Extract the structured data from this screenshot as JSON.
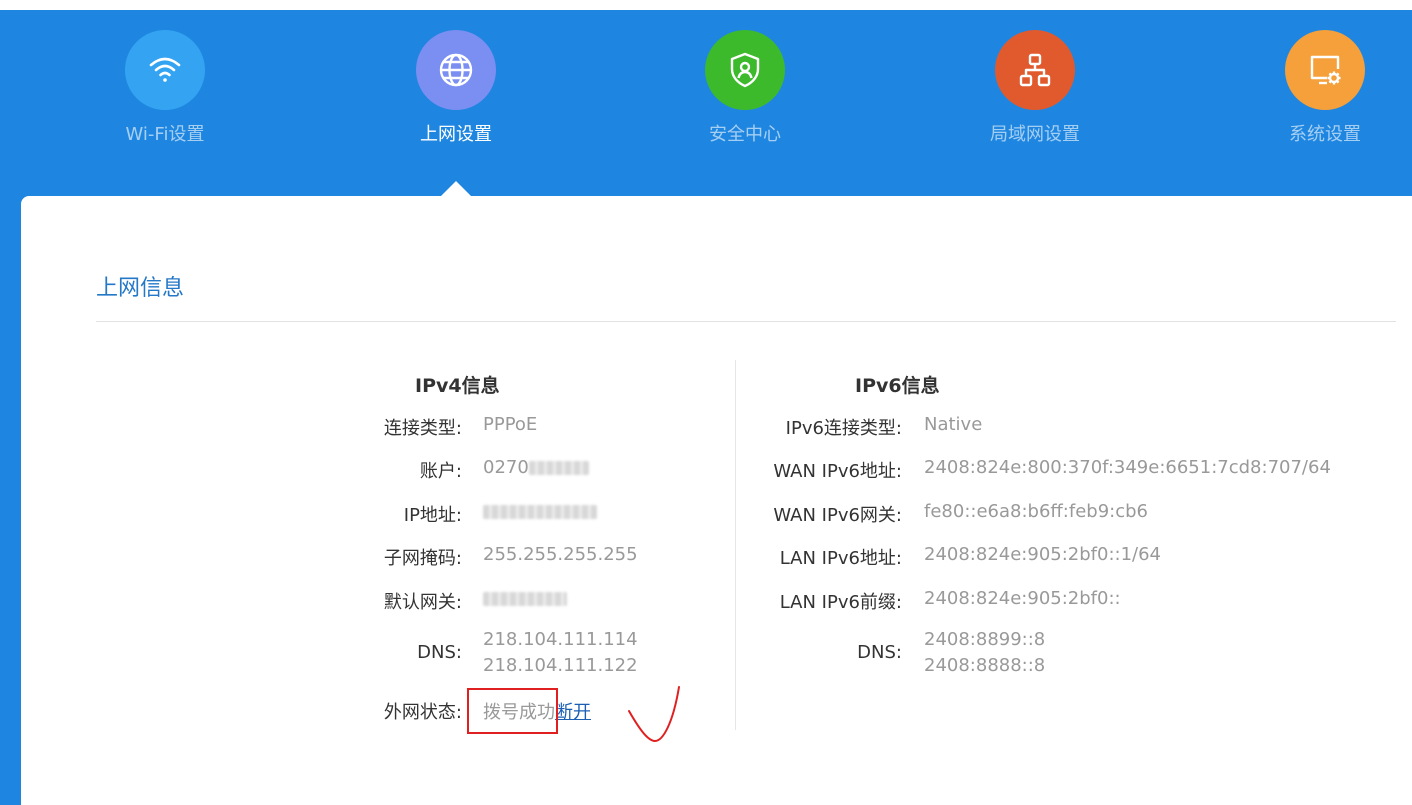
{
  "nav": {
    "items": [
      {
        "label": "Wi-Fi设置",
        "icon": "wifi-icon",
        "color": "#34a4f2"
      },
      {
        "label": "上网设置",
        "icon": "globe-icon",
        "color": "#7b8ef2",
        "active": true
      },
      {
        "label": "安全中心",
        "icon": "shield-user-icon",
        "color": "#3cba2c"
      },
      {
        "label": "局域网设置",
        "icon": "network-topology-icon",
        "color": "#e15a2e"
      },
      {
        "label": "系统设置",
        "icon": "monitor-gear-icon",
        "color": "#f5a03a"
      }
    ]
  },
  "section": {
    "title": "上网信息"
  },
  "ipv4": {
    "title": "IPv4信息",
    "conn_type": {
      "label": "连接类型:",
      "value": "PPPoE"
    },
    "account": {
      "label": "账户:",
      "value_prefix": "0270"
    },
    "ip": {
      "label": "IP地址:"
    },
    "mask": {
      "label": "子网掩码:",
      "value": "255.255.255.255"
    },
    "gateway": {
      "label": "默认网关:"
    },
    "dns": {
      "label": "DNS:",
      "values": [
        "218.104.111.114",
        "218.104.111.122"
      ]
    },
    "wan_status": {
      "label": "外网状态:",
      "value": "拨号成功",
      "action": "断开"
    }
  },
  "ipv6": {
    "title": "IPv6信息",
    "conn_type": {
      "label": "IPv6连接类型:",
      "value": "Native"
    },
    "wan_addr": {
      "label": "WAN IPv6地址:",
      "value": "2408:824e:800:370f:349e:6651:7cd8:707/64"
    },
    "wan_gw": {
      "label": "WAN IPv6网关:",
      "value": "fe80::e6a8:b6ff:feb9:cb6"
    },
    "lan_addr": {
      "label": "LAN IPv6地址:",
      "value": "2408:824e:905:2bf0::1/64"
    },
    "lan_prefix": {
      "label": "LAN IPv6前缀:",
      "value": "2408:824e:905:2bf0::"
    },
    "dns": {
      "label": "DNS:",
      "values": [
        "2408:8899::8",
        "2408:8888::8"
      ]
    }
  },
  "colors": {
    "topbar": "#1e86e0",
    "title": "#2478c8",
    "annotation": "#e02020"
  }
}
